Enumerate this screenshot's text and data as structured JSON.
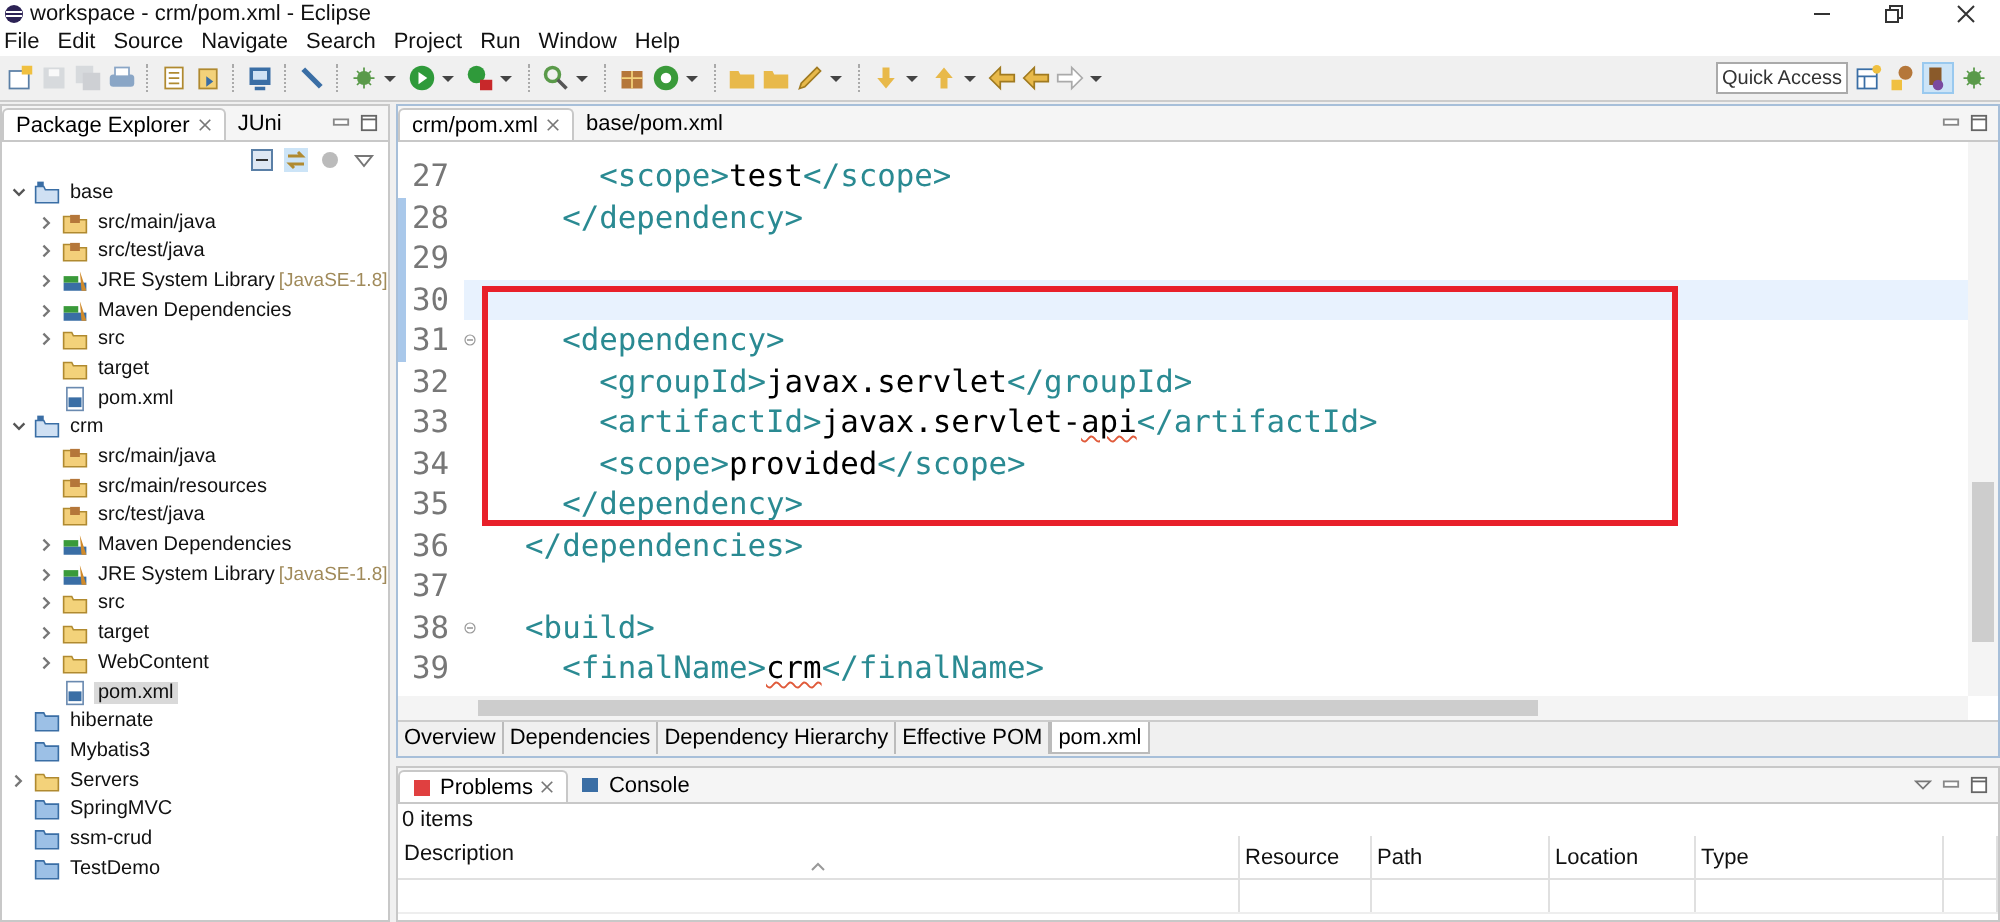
{
  "window": {
    "title": "workspace - crm/pom.xml - Eclipse"
  },
  "menu": [
    "File",
    "Edit",
    "Source",
    "Navigate",
    "Search",
    "Project",
    "Run",
    "Window",
    "Help"
  ],
  "quick_access": {
    "placeholder": "Quick Access"
  },
  "explorer": {
    "tabs": [
      {
        "label": "Package Explorer",
        "selected": true,
        "closable": true
      },
      {
        "label": "JUni",
        "selected": false,
        "closable": false
      }
    ],
    "tree": [
      {
        "label": "base",
        "kind": "project",
        "expanded": true,
        "selected": false,
        "children": [
          {
            "label": "src/main/java",
            "kind": "package",
            "expanded": false,
            "selected": false
          },
          {
            "label": "src/test/java",
            "kind": "package",
            "expanded": false,
            "selected": false
          },
          {
            "label": "JRE System Library",
            "suffix": "[JavaSE-1.8]",
            "kind": "library",
            "expanded": false,
            "selected": false
          },
          {
            "label": "Maven Dependencies",
            "kind": "library",
            "expanded": false,
            "selected": false
          },
          {
            "label": "src",
            "kind": "folder",
            "expanded": false,
            "selected": false
          },
          {
            "label": "target",
            "kind": "folder",
            "selected": false
          },
          {
            "label": "pom.xml",
            "kind": "file",
            "selected": false
          }
        ]
      },
      {
        "label": "crm",
        "kind": "project",
        "expanded": true,
        "selected": false,
        "children": [
          {
            "label": "src/main/java",
            "kind": "package",
            "selected": false
          },
          {
            "label": "src/main/resources",
            "kind": "package",
            "selected": false
          },
          {
            "label": "src/test/java",
            "kind": "package",
            "selected": false
          },
          {
            "label": "Maven Dependencies",
            "kind": "library",
            "expanded": false,
            "selected": false
          },
          {
            "label": "JRE System Library",
            "suffix": "[JavaSE-1.8]",
            "kind": "library",
            "expanded": false,
            "selected": false
          },
          {
            "label": "src",
            "kind": "folder",
            "expanded": false,
            "selected": false
          },
          {
            "label": "target",
            "kind": "folder",
            "expanded": false,
            "selected": false
          },
          {
            "label": "WebContent",
            "kind": "folder",
            "expanded": false,
            "selected": false
          },
          {
            "label": "pom.xml",
            "kind": "file",
            "selected": true
          }
        ]
      },
      {
        "label": "hibernate",
        "kind": "closed",
        "selected": false
      },
      {
        "label": "Mybatis3",
        "kind": "closed",
        "selected": false
      },
      {
        "label": "Servers",
        "kind": "folder",
        "expanded": false,
        "selected": false
      },
      {
        "label": "SpringMVC",
        "kind": "closed",
        "selected": false
      },
      {
        "label": "ssm-crud",
        "kind": "closed",
        "selected": false
      },
      {
        "label": "TestDemo",
        "kind": "closed",
        "selected": false
      }
    ]
  },
  "editor": {
    "tabs": [
      {
        "label": "crm/pom.xml",
        "selected": true,
        "closable": true
      },
      {
        "label": "base/pom.xml",
        "selected": false,
        "closable": false
      }
    ],
    "lines": [
      {
        "number": "27",
        "current": false,
        "changed": false,
        "fold": false,
        "segments": [
          {
            "kind": "tag",
            "text": "      <scope>"
          },
          {
            "kind": "text",
            "text": "test"
          },
          {
            "kind": "tag",
            "text": "</scope>"
          }
        ]
      },
      {
        "number": "28",
        "current": false,
        "changed": true,
        "fold": false,
        "segments": [
          {
            "kind": "tag",
            "text": "    </dependency>"
          }
        ]
      },
      {
        "number": "29",
        "current": false,
        "changed": true,
        "fold": false
      },
      {
        "number": "30",
        "current": true,
        "changed": true,
        "fold": false
      },
      {
        "number": "31",
        "current": false,
        "changed": true,
        "fold": true,
        "segments": [
          {
            "kind": "tag",
            "text": "    <dependency>"
          }
        ]
      },
      {
        "number": "32",
        "current": false,
        "changed": false,
        "fold": false,
        "segments": [
          {
            "kind": "tag",
            "text": "      <groupId>"
          },
          {
            "kind": "text",
            "text": "javax.servlet"
          },
          {
            "kind": "tag",
            "text": "</groupId>"
          }
        ]
      },
      {
        "number": "33",
        "current": false,
        "changed": false,
        "fold": false,
        "segments": [
          {
            "kind": "tag",
            "text": "      <artifactId>"
          },
          {
            "kind": "text",
            "text": "javax.servlet-"
          },
          {
            "kind": "misspelled",
            "text": "api"
          },
          {
            "kind": "tag",
            "text": "</artifactId>"
          }
        ]
      },
      {
        "number": "34",
        "current": false,
        "changed": false,
        "fold": false,
        "segments": [
          {
            "kind": "tag",
            "text": "      <scope>"
          },
          {
            "kind": "text",
            "text": "provided"
          },
          {
            "kind": "tag",
            "text": "</scope>"
          }
        ]
      },
      {
        "number": "35",
        "current": false,
        "changed": false,
        "fold": false,
        "segments": [
          {
            "kind": "tag",
            "text": "    </dependency>"
          }
        ]
      },
      {
        "number": "36",
        "current": false,
        "changed": false,
        "fold": false,
        "segments": [
          {
            "kind": "tag",
            "text": "  </dependencies>"
          }
        ]
      },
      {
        "number": "37",
        "current": false,
        "changed": false,
        "fold": false
      },
      {
        "number": "38",
        "current": false,
        "changed": false,
        "fold": true,
        "segments": [
          {
            "kind": "tag",
            "text": "  <build>"
          }
        ]
      },
      {
        "number": "39",
        "current": false,
        "changed": false,
        "fold": false,
        "segments": [
          {
            "kind": "tag",
            "text": "    <finalName>"
          },
          {
            "kind": "misspelled",
            "text": "crm"
          },
          {
            "kind": "tag",
            "text": "</finalName>"
          }
        ]
      }
    ],
    "page_tabs": [
      {
        "label": "Overview",
        "selected": false
      },
      {
        "label": "Dependencies",
        "selected": false
      },
      {
        "label": "Dependency Hierarchy",
        "selected": false
      },
      {
        "label": "Effective POM",
        "selected": false
      },
      {
        "label": "pom.xml",
        "selected": true
      }
    ]
  },
  "problems": {
    "tabs": [
      {
        "label": "Problems",
        "selected": true,
        "closable": true
      },
      {
        "label": "Console",
        "selected": false,
        "closable": false
      }
    ],
    "summary": "0 items",
    "columns": [
      "Description",
      "Resource",
      "Path",
      "Location",
      "Type"
    ]
  }
}
